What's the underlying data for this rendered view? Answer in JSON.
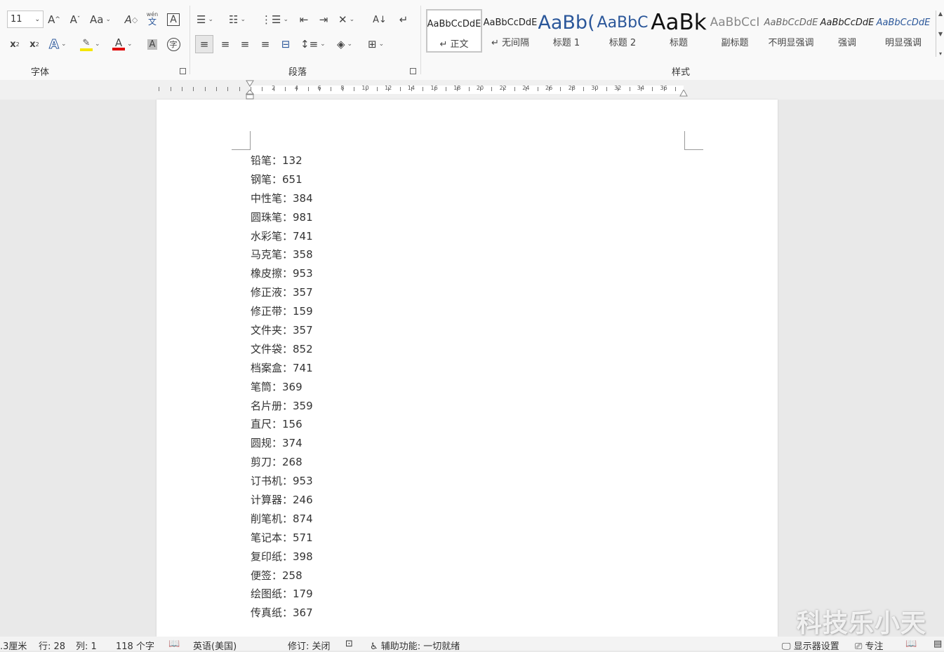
{
  "ribbon": {
    "font_size_value": "11",
    "groups": {
      "font": "字体",
      "paragraph": "段落",
      "styles": "样式"
    },
    "font_buttons": {
      "grow": "A",
      "shrink": "A",
      "change_case": "Aa",
      "subscript": "x",
      "superscript": "x",
      "pinyin_top": "wén",
      "pinyin_bottom": "文",
      "char_border": "A",
      "text_effect": "A",
      "font_color": "A",
      "char_shading": "A",
      "enclose_char": "字"
    },
    "accent_colors": {
      "highlight": "#f5e600",
      "font_color": "#e00000",
      "blue_icon": "#2b579a"
    },
    "styles": [
      {
        "sample": "AaBbCcDdE",
        "name": "↵ 正文",
        "selected": true
      },
      {
        "sample": "AaBbCcDdE",
        "name": "↵ 无间隔",
        "selected": false
      },
      {
        "sample": "AaBb(",
        "name": "标题 1",
        "selected": false
      },
      {
        "sample": "AaBbC",
        "name": "标题 2",
        "selected": false
      },
      {
        "sample": "AaBk",
        "name": "标题",
        "selected": false
      },
      {
        "sample": "AaBbCcI",
        "name": "副标题",
        "selected": false
      },
      {
        "sample": "AaBbCcDdE",
        "name": "不明显强调",
        "selected": false
      },
      {
        "sample": "AaBbCcDdE",
        "name": "强调",
        "selected": false
      },
      {
        "sample": "AaBbCcDdE",
        "name": "明显强调",
        "selected": false
      }
    ]
  },
  "ruler": {
    "numbers": [
      "2",
      "4",
      "6",
      "8",
      "10",
      "12",
      "14",
      "16",
      "18",
      "20",
      "22",
      "24",
      "26",
      "28",
      "30",
      "32",
      "34",
      "36"
    ]
  },
  "document": {
    "lines": [
      "铅笔：132",
      "钢笔：651",
      "中性笔：384",
      "圆珠笔：981",
      "水彩笔：741",
      "马克笔：358",
      "橡皮擦：953",
      "修正液：357",
      "修正带：159",
      "文件夹：357",
      "文件袋：852",
      "档案盒：741",
      "笔筒：369",
      "名片册：359",
      "直尺：156",
      "圆规：374",
      "剪刀：268",
      "订书机：953",
      "计算器：246",
      "削笔机：874",
      "笔记本：571",
      "复印纸：398",
      "便签：258",
      "绘图纸：179",
      "传真纸：367"
    ]
  },
  "statusbar": {
    "position": ".3厘米",
    "line": "行: 28",
    "column": "列: 1",
    "word_count": "118 个字",
    "language": "英语(美国)",
    "track_changes": "修订: 关闭",
    "accessibility": "辅助功能: 一切就绪",
    "display_settings": "显示器设置",
    "focus": "专注"
  },
  "watermark": "科技乐小天"
}
